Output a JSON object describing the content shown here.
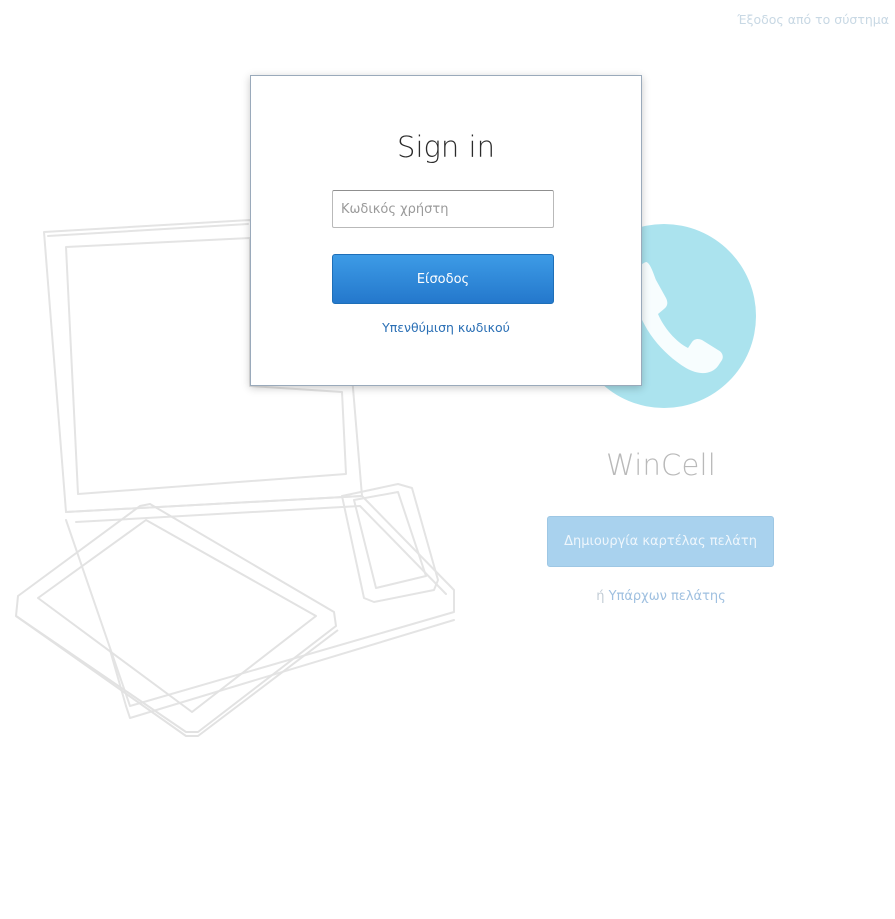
{
  "header": {
    "logout_label": "Έξοδος από το σύστημα"
  },
  "brand": {
    "name": "WinCell",
    "create_account_label": "Δημιουργία καρτέλας πελάτη",
    "or_word": "ή",
    "existing_customer_label": "Υπάρχων πελάτης",
    "accent_color": "#abe3ee"
  },
  "signin": {
    "title": "Sign in",
    "username_placeholder": "Κωδικός χρήστη",
    "username_value": "",
    "login_label": "Είσοδος",
    "forgot_label": "Υπενθύμιση κωδικού",
    "button_color": "#2b86d8"
  }
}
